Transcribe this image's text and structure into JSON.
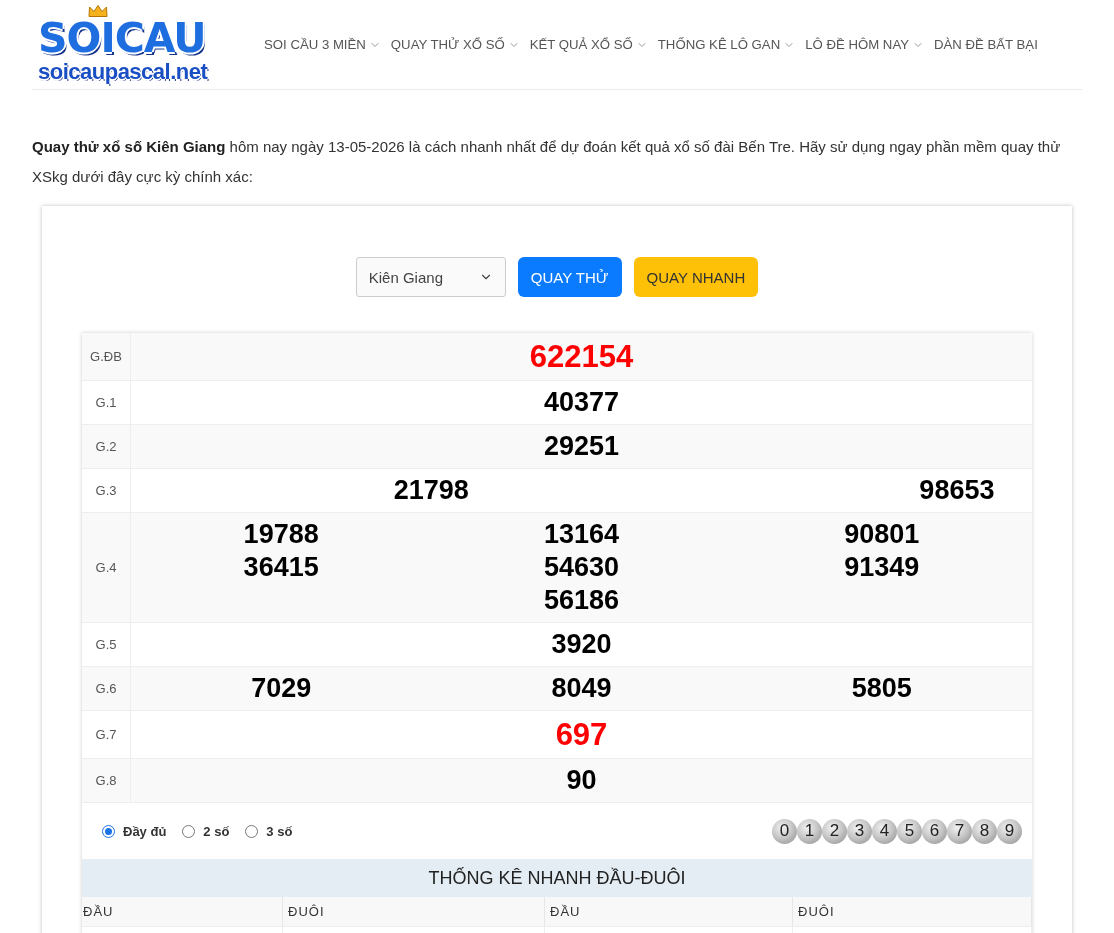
{
  "logo": {
    "title": "SOICAU",
    "subtitle": "soicaupascal.net"
  },
  "nav": [
    {
      "label": "SOI CẦU 3 MIỀN",
      "has_dropdown": true
    },
    {
      "label": "QUAY THỬ XỔ SỐ",
      "has_dropdown": true
    },
    {
      "label": "KẾT QUẢ XỔ SỐ",
      "has_dropdown": true
    },
    {
      "label": "THỐNG KÊ LÔ GAN",
      "has_dropdown": true
    },
    {
      "label": "LÔ ĐỀ HÔM NAY",
      "has_dropdown": true
    },
    {
      "label": "DÀN ĐỀ BẤT BẠI",
      "has_dropdown": false
    }
  ],
  "intro": "**Quay thử xổ số Kiên Giang** hôm nay ngày 13-05-2026 là cách nhanh nhất để dự đoán kết quả xổ số đài Bến Tre. Hãy sử dụng ngay phần mềm quay thử XSkg dưới đây cực kỳ chính xác:",
  "controls": {
    "province": "Kiên Giang",
    "buttons": [
      {
        "label": "QUAY THỬ",
        "kind": "primary"
      },
      {
        "label": "QUAY NHANH",
        "kind": "warning"
      }
    ]
  },
  "prizes": [
    {
      "label": "G.ĐB",
      "highlight": true,
      "columns": [
        [
          "622154"
        ]
      ]
    },
    {
      "label": "G.1",
      "highlight": false,
      "columns": [
        [
          "40377"
        ]
      ]
    },
    {
      "label": "G.2",
      "highlight": false,
      "columns": [
        [
          "29251"
        ]
      ]
    },
    {
      "label": "G.3",
      "highlight": false,
      "columns": [
        [
          "21798"
        ],
        [
          "98653"
        ]
      ]
    },
    {
      "label": "G.4",
      "highlight": false,
      "columns": [
        [
          "19788",
          "36415"
        ],
        [
          "13164",
          "54630",
          "56186"
        ],
        [
          "90801",
          "91349"
        ]
      ]
    },
    {
      "label": "G.5",
      "highlight": false,
      "columns": [
        [
          "3920"
        ]
      ]
    },
    {
      "label": "G.6",
      "highlight": false,
      "columns": [
        [
          "7029"
        ],
        [
          "8049"
        ],
        [
          "5805"
        ]
      ]
    },
    {
      "label": "G.7",
      "highlight": true,
      "columns": [
        [
          "697"
        ]
      ]
    },
    {
      "label": "G.8",
      "highlight": false,
      "columns": [
        [
          "90"
        ]
      ]
    }
  ],
  "display_options": [
    {
      "label": "Đầy đủ",
      "selected": true
    },
    {
      "label": "2 số",
      "selected": false
    },
    {
      "label": "3 số",
      "selected": false
    }
  ],
  "digits": [
    "0",
    "1",
    "2",
    "3",
    "4",
    "5",
    "6",
    "7",
    "8",
    "9"
  ],
  "stats": {
    "title": "THỐNG KÊ NHANH ĐẦU-ĐUÔI",
    "columns": [
      "ĐẦU",
      "ĐUÔI",
      "ĐẦU",
      "ĐUÔI"
    ]
  }
}
